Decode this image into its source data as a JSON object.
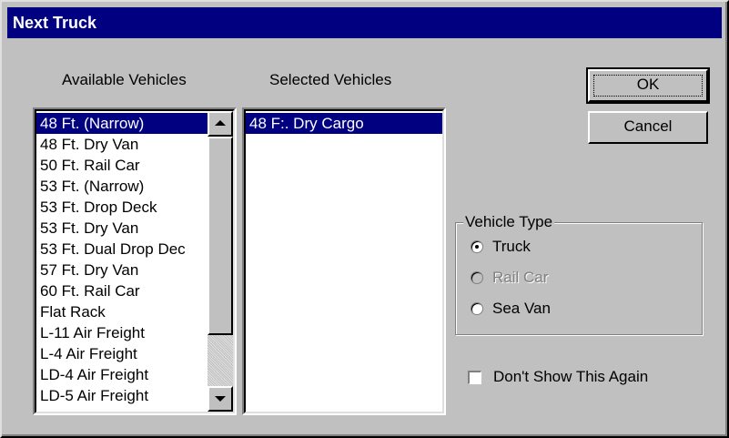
{
  "window": {
    "title": "Next Truck"
  },
  "available": {
    "label": "Available Vehicles",
    "items": [
      "48 Ft. (Narrow)",
      "48 Ft. Dry Van",
      "50 Ft. Rail Car",
      "53 Ft. (Narrow)",
      "53 Ft. Drop Deck",
      "53 Ft. Dry Van",
      "53 Ft. Dual Drop Dec",
      "57 Ft. Dry Van",
      "60 Ft. Rail Car",
      "Flat Rack",
      "L-11 Air Freight",
      "L-4 Air Freight",
      "LD-4 Air Freight",
      "LD-5 Air Freight"
    ],
    "selected_index": 0
  },
  "selected": {
    "label": "Selected Vehicles",
    "items": [
      "48 F:. Dry Cargo"
    ],
    "selected_index": 0
  },
  "buttons": {
    "ok_label": "OK",
    "cancel_label": "Cancel"
  },
  "vehicle_type": {
    "title": "Vehicle Type",
    "options": [
      {
        "label": "Truck",
        "checked": true,
        "enabled": true
      },
      {
        "label": "Rail Car",
        "checked": false,
        "enabled": false
      },
      {
        "label": "Sea Van",
        "checked": false,
        "enabled": true
      }
    ]
  },
  "dont_show": {
    "label": "Don't Show This Again",
    "checked": false
  },
  "colors": {
    "titlebar": "#000080",
    "face": "#c0c0c0",
    "selection": "#000080"
  }
}
